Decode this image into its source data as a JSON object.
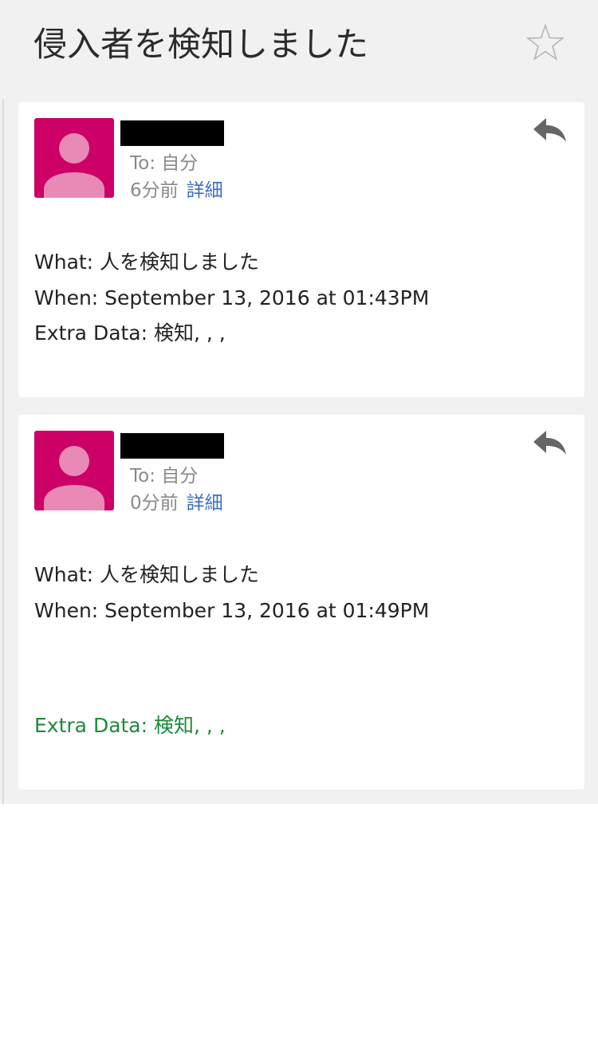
{
  "header": {
    "subject": "侵入者を検知しました",
    "star_icon": "star-outline-icon"
  },
  "messages": [
    {
      "to": "To: 自分",
      "time": "6分前",
      "details_label": "詳細",
      "what": "What: 人を検知しました",
      "when": "When: September 13, 2016 at 01:43PM",
      "extra": "Extra Data: 検知, , ,"
    },
    {
      "to": "To: 自分",
      "time": "0分前",
      "details_label": "詳細",
      "what": "What: 人を検知しました",
      "when": "When: September 13, 2016 at 01:49PM",
      "extra": "Extra Data: 検知, , ,"
    }
  ],
  "colors": {
    "avatar_bg": "#cc0066",
    "avatar_figure": "#e88ab5",
    "link": "#3d6dc4",
    "extra_highlight": "#1e8a3a",
    "header_bg": "#f1f1f1"
  }
}
